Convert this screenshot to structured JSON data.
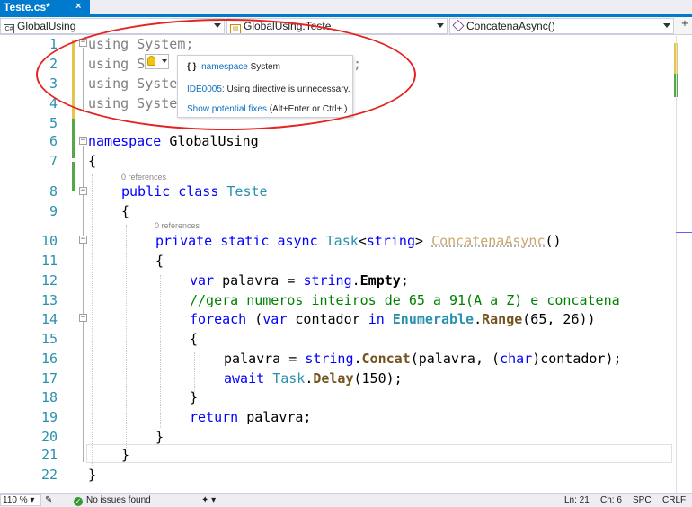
{
  "tab": {
    "label": "Teste.cs*",
    "close": "×"
  },
  "navbar": {
    "project": "GlobalUsing",
    "class": "GlobalUsing.Teste",
    "member": "ConcatenaAsync()",
    "split": "+"
  },
  "lines": [
    {
      "n": "1",
      "text": "using System;"
    },
    {
      "n": "2",
      "text": "using System.Linq;"
    },
    {
      "n": "3",
      "text": "using System"
    },
    {
      "n": "4",
      "text": "using System"
    },
    {
      "n": "5",
      "text": ""
    },
    {
      "n": "6",
      "text": "namespace GlobalUsing"
    },
    {
      "n": "7",
      "text": "{"
    },
    {
      "n": "8",
      "text": "public class Teste"
    },
    {
      "n": "9",
      "text": "{"
    },
    {
      "n": "10",
      "text": "private static async Task<string> ConcatenaAsync()"
    },
    {
      "n": "11",
      "text": "{"
    },
    {
      "n": "12",
      "text": "var palavra = string.Empty;"
    },
    {
      "n": "13",
      "text": "//gera numeros inteiros de 65 a 91(A a Z) e concatena"
    },
    {
      "n": "14",
      "text": "foreach (var contador in Enumerable.Range(65, 26))"
    },
    {
      "n": "15",
      "text": "{"
    },
    {
      "n": "16",
      "text": "palavra = string.Concat(palavra, (char)contador);"
    },
    {
      "n": "17",
      "text": "await Task.Delay(150);"
    },
    {
      "n": "18",
      "text": "}"
    },
    {
      "n": "19",
      "text": "return palavra;"
    },
    {
      "n": "20",
      "text": "}"
    },
    {
      "n": "21",
      "text": "}"
    },
    {
      "n": "22",
      "text": "}"
    }
  ],
  "tokens": {
    "using": "using",
    "system": "System",
    "sem": ";",
    "namespace": "namespace",
    "globalusing": "GlobalUsing",
    "public": "public",
    "class": "class",
    "teste": "Teste",
    "private": "private",
    "static": "static",
    "async": "async",
    "task": "Task",
    "lt": "<",
    "string": "string",
    "gt": ">",
    "concatenaasync": "ConcatenaAsync",
    "parens": "()",
    "var": "var",
    "palavra": "palavra",
    "eq": "=",
    "dot": ".",
    "empty": "Empty",
    "comment": "//gera numeros inteiros de 65 a 91(A a Z) e concatena",
    "foreach": "foreach",
    "lparen": "(",
    "contador": "contador",
    "in": "in",
    "enumerable": "Enumerable",
    "range": "Range",
    "range_args": "(65, 26))",
    "concat": "Concat",
    "concat_args_a": "(palavra, (",
    "char": "char",
    "concat_args_b": ")contador);",
    "await": "await",
    "delay": "Delay",
    "delay_args": "(150);",
    "return": "return",
    "ret_tail": " palavra;",
    "lbrace": "{",
    "rbrace": "}",
    "hidden_tail": "t;"
  },
  "references": "0 references",
  "lightbulb": {
    "icon": "lightbulb-icon"
  },
  "tooltip": {
    "icon": "{ }",
    "ns_keyword": "namespace",
    "ns_name": "System",
    "diag_code": "IDE0005",
    "diag_message": ": Using directive is unnecessary.",
    "fix_link": "Show potential fixes",
    "fix_shortcut": "(Alt+Enter or Ctrl+.)"
  },
  "status": {
    "zoom": "110 %",
    "issues": "No issues found",
    "ln": "Ln: 21",
    "ch": "Ch: 6",
    "spc": "SPC",
    "crlf": "CRLF"
  },
  "colors": {
    "accent": "#007acc",
    "keyword": "#0000ff",
    "type": "#2b91af",
    "comment": "#008000",
    "annotation": "#e52421"
  }
}
